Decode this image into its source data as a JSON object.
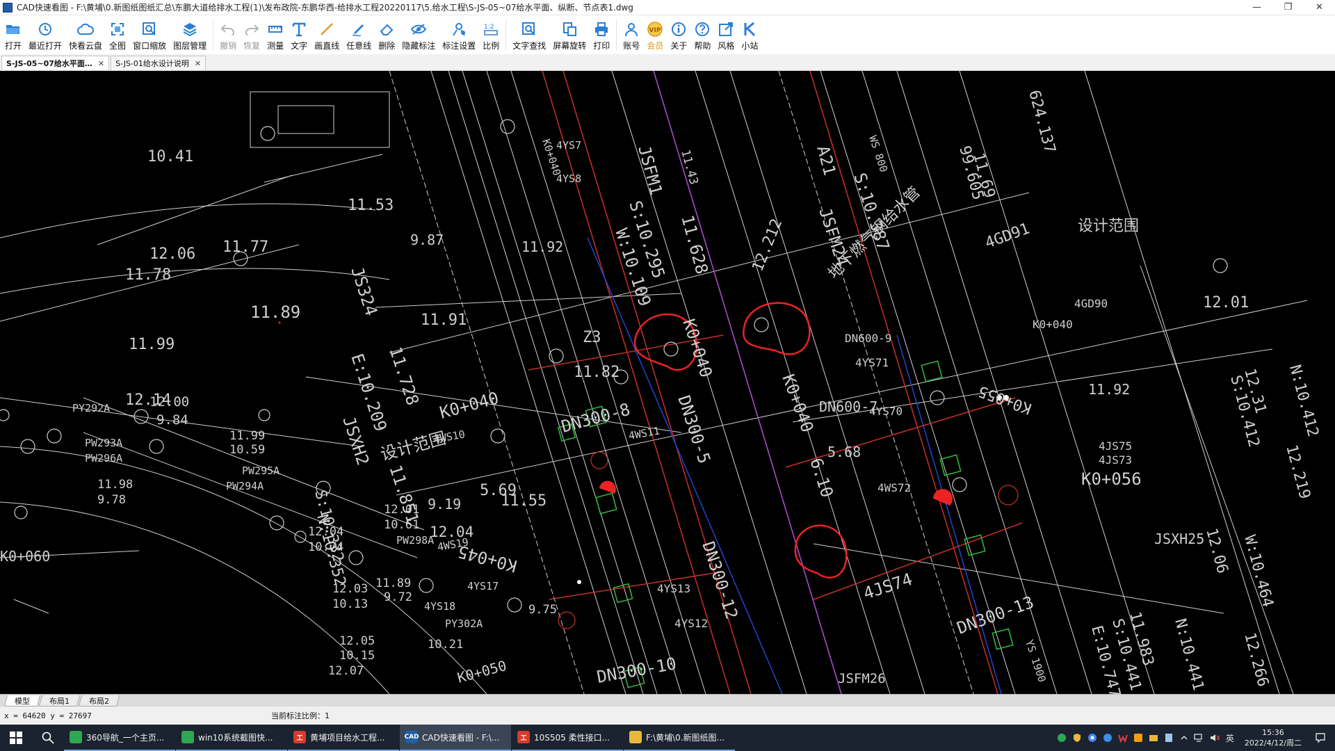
{
  "window": {
    "title": "CAD快速看图 - F:\\黄埔\\0.新图纸图纸汇总\\东鹏大道给排水工程(1)\\发布政院-东鹏华西-给排水工程20220117\\5.给水工程\\S-JS-05~07给水平面、纵断、节点表1.dwg",
    "minimize": "—",
    "restore": "❐",
    "close": "✕"
  },
  "toolbar": {
    "open": "打开",
    "recent": "最近打开",
    "cloud": "快看云盘",
    "full": "全图",
    "zoom_window": "窗口缩放",
    "layers": "图层管理",
    "undo": "撤销",
    "redo": "恢复",
    "measure": "测量",
    "text": "文字",
    "line": "画直线",
    "freeline": "任意线",
    "erase": "删除",
    "hide_marks": "隐藏标注",
    "mark_settings": "标注设置",
    "scale": "比例",
    "text_search": "文字查找",
    "rotate": "屏幕旋转",
    "print": "打印",
    "account": "账号",
    "vip": "会员",
    "about": "关于",
    "help": "帮助",
    "style": "风格",
    "station": "小站",
    "vip_badge": "VIP"
  },
  "doc_tabs": [
    {
      "label": "S-JS-05~07给水平面…",
      "close": "✕"
    },
    {
      "label": "S-JS-01给水设计说明",
      "close": "✕"
    }
  ],
  "layout_tabs": [
    "模型",
    "布局1",
    "布局2"
  ],
  "status": {
    "coords": "x = 64620  y = 27697",
    "scale_text": "当前标注比例：1"
  },
  "taskbar": {
    "items": [
      {
        "label": "360导航_一个主页...",
        "color": "#2fa84f",
        "glyph": ""
      },
      {
        "label": "win10系统截图快...",
        "color": "#2fa84f",
        "glyph": ""
      },
      {
        "label": "黄埔项目给水工程...",
        "color": "#d63b2a",
        "glyph": "工"
      },
      {
        "label": "CAD快速看图 - F:\\...",
        "color": "#1f5fa8",
        "glyph": "CAD"
      },
      {
        "label": "10S505 柔性接口...",
        "color": "#d63b2a",
        "glyph": "工"
      },
      {
        "label": "F:\\黄埔\\0.新图纸图...",
        "color": "#e8b93a",
        "glyph": ""
      }
    ],
    "ime": "英",
    "time": "15:36",
    "date": "2022/4/12/周二"
  },
  "drawing": {
    "labels": [
      "10.41",
      "11.53",
      "12.06",
      "11.77",
      "11.78",
      "11.89",
      "11.91",
      "11.99",
      "12.14",
      "9.87",
      "11.92",
      "4YS8",
      "4YS7",
      "JS324",
      "E:10.209",
      "11.728",
      "JSXH2",
      "S:10.332",
      "11.851",
      "N:10.352",
      "设计范围",
      "4WS10",
      "K0+040",
      "4WS11",
      "DN300-8",
      "11.82",
      "Z3",
      "JSFM1",
      "S:10.295",
      "W:10.109",
      "11.628",
      "11.43",
      "K0+040",
      "DN300-5",
      "DN300-12",
      "K0+045",
      "4YS13",
      "4YS12",
      "DN300-10",
      "4WS19",
      "5.69",
      "11.55",
      "9.19",
      "PY292A",
      "PW293A",
      "PW296A",
      "PW295A",
      "PW294A",
      "12.00",
      "9.84",
      "11.99",
      "10.59",
      "11.98",
      "9.78",
      "12.01",
      "10.61",
      "PW298A",
      "12.04",
      "12.04",
      "10.74",
      "12.03",
      "10.13",
      "12.05",
      "10.15",
      "12.07",
      "11.89",
      "9.72",
      "9.75",
      "4YS17",
      "4YS18",
      "PY302A",
      "10.21",
      "K0+050",
      "K0+060",
      "A21",
      "JSFM24",
      "S:10.387",
      "12.212",
      "地下燃气钢给水管",
      "K0+040",
      "DN600-7",
      "5.68",
      "6.10",
      "DN600-9",
      "4YS71",
      "4YS70",
      "4WS72",
      "4JS75",
      "4JS73",
      "4JS74",
      "DN300-13",
      "K0+056",
      "K0+055",
      "K0+040",
      "4GD90",
      "4GD91",
      "设计范围",
      "12.01",
      "11.92",
      "12.31",
      "S:10.412",
      "N:10.412",
      "12.219",
      "JSXH25",
      "12.06",
      "W:10.464",
      "11.983",
      "S:10.441",
      "E:10.747",
      "N:10.441",
      "12.266",
      "JSFM26",
      "11.69",
      "99.605",
      "624.137",
      "K0+040",
      "WS 800",
      "YS 1900",
      "WS 800"
    ]
  }
}
